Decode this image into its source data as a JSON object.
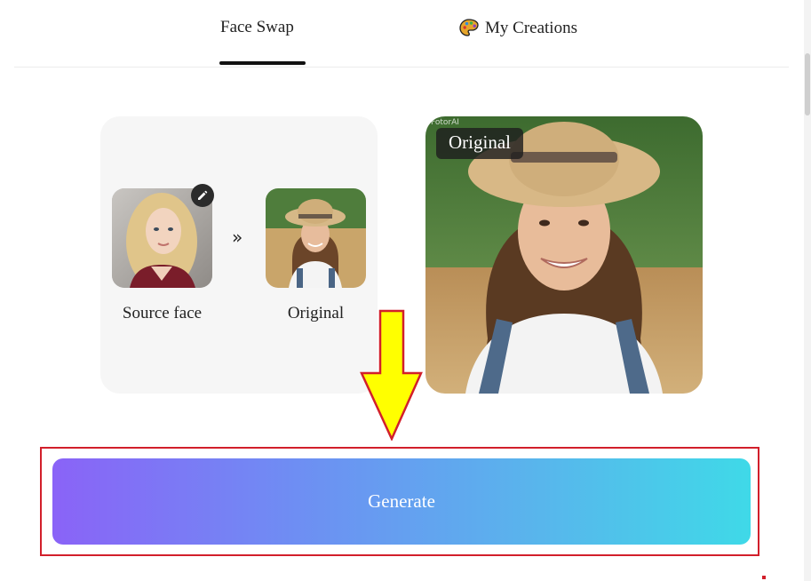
{
  "tabs": {
    "face_swap": "Face Swap",
    "my_creations": "My Creations"
  },
  "panel": {
    "source_caption": "Source face",
    "original_caption": "Original",
    "arrow_glyph": "»"
  },
  "preview": {
    "badge": "Original",
    "watermark": "FotorAI"
  },
  "actions": {
    "generate_label": "Generate"
  },
  "colors": {
    "gradient_start": "#8a63f7",
    "gradient_end": "#3fd9e8",
    "highlight": "#d21f2b",
    "arrow_fill": "#ffff00"
  },
  "icons": {
    "creations": "palette-icon",
    "edit": "pencil-icon"
  }
}
